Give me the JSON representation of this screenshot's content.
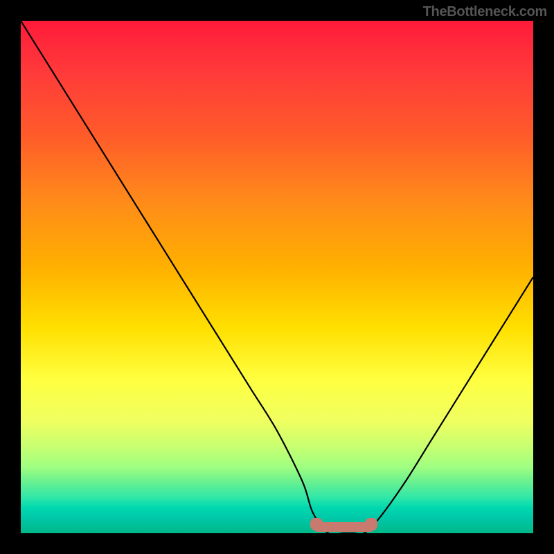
{
  "watermark": "TheBottleneck.com",
  "chart_data": {
    "type": "line",
    "title": "",
    "xlabel": "",
    "ylabel": "",
    "xlim": [
      0,
      100
    ],
    "ylim": [
      0,
      100
    ],
    "x": [
      0,
      5,
      10,
      15,
      20,
      25,
      30,
      35,
      40,
      45,
      50,
      55,
      57,
      60,
      63,
      65,
      67,
      70,
      75,
      80,
      85,
      90,
      95,
      100
    ],
    "values": [
      100,
      92,
      84,
      76,
      68,
      60,
      52,
      44,
      36,
      28,
      20,
      10,
      4,
      0,
      0,
      0,
      0,
      3,
      10,
      18,
      26,
      34,
      42,
      50
    ],
    "flat_region": {
      "x_start": 57,
      "x_end": 69,
      "y": 0
    },
    "background_gradient": {
      "top_color": "#ff1a3a",
      "mid_color": "#ffe000",
      "bottom_color": "#00b888"
    },
    "marker_color": "#c97a6e",
    "grid": false
  }
}
